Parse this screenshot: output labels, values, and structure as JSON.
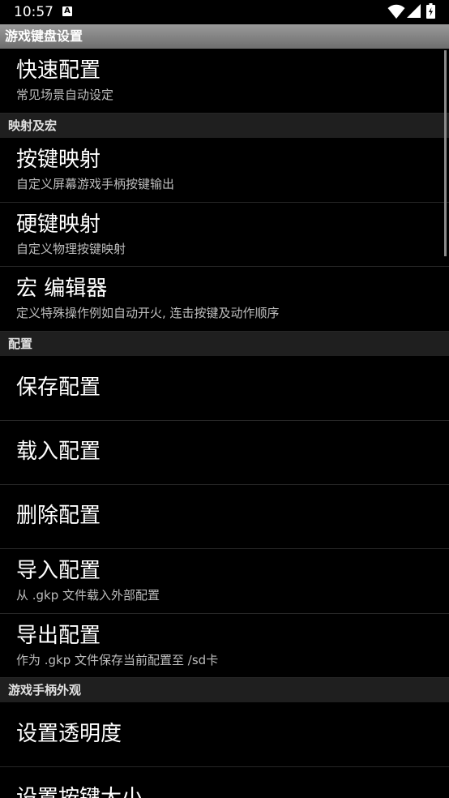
{
  "status_bar": {
    "time": "10:57",
    "notification_letter": "A"
  },
  "title_bar": {
    "title": "游戏键盘设置"
  },
  "items": [
    {
      "title": "快速配置",
      "subtitle": "常见场景自动设定"
    },
    {
      "title": "按键映射",
      "subtitle": "自定义屏幕游戏手柄按键输出"
    },
    {
      "title": "硬键映射",
      "subtitle": "自定义物理按键映射"
    },
    {
      "title": "宏 编辑器",
      "subtitle": "定义特殊操作例如自动开火, 连击按键及动作顺序"
    },
    {
      "title": "保存配置"
    },
    {
      "title": "载入配置"
    },
    {
      "title": "删除配置"
    },
    {
      "title": "导入配置",
      "subtitle": "从 .gkp 文件载入外部配置"
    },
    {
      "title": "导出配置",
      "subtitle": "作为 .gkp 文件保存当前配置至 /sd卡"
    },
    {
      "title": "设置透明度"
    },
    {
      "title": "设置按键大小"
    }
  ],
  "sections": [
    {
      "label": "映射及宏"
    },
    {
      "label": "配置"
    },
    {
      "label": "游戏手柄外观"
    }
  ]
}
